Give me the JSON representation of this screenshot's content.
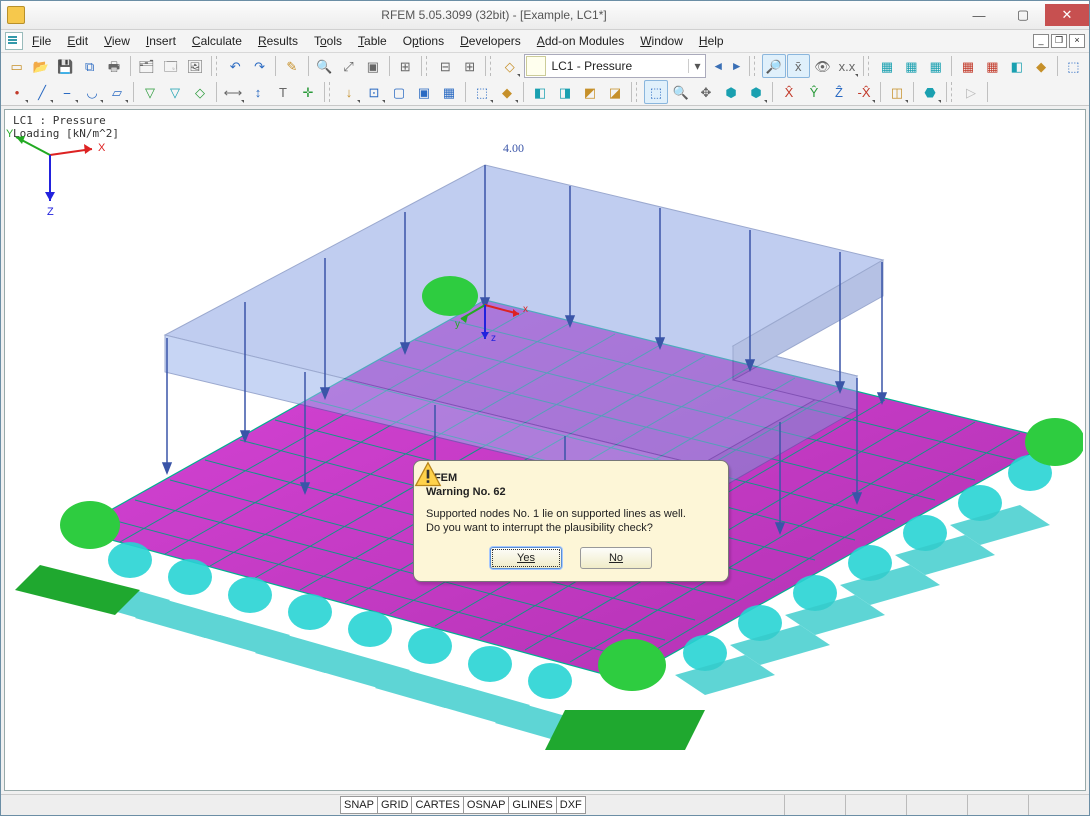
{
  "window": {
    "title": "RFEM 5.05.3099 (32bit) - [Example, LC1*]"
  },
  "menus": [
    "File",
    "Edit",
    "View",
    "Insert",
    "Calculate",
    "Results",
    "Tools",
    "Table",
    "Options",
    "Developers",
    "Add-on Modules",
    "Window",
    "Help"
  ],
  "load_case": {
    "selected": "LC1 - Pressure"
  },
  "viewport": {
    "label_line1": "LC1 : Pressure",
    "label_line2": "Loading [kN/m^2]",
    "load_value": "4.00",
    "triad": {
      "x": "X",
      "y": "Y",
      "z": "Z"
    }
  },
  "dialog": {
    "app": "RFEM",
    "title": "Warning No. 62",
    "text_line1": "Supported nodes No. 1 lie on supported lines as well.",
    "text_line2": "Do you want to interrupt the plausibility check?",
    "yes": "Yes",
    "no": "No"
  },
  "status_buttons": [
    "SNAP",
    "GRID",
    "CARTES",
    "OSNAP",
    "GLINES",
    "DXF"
  ]
}
